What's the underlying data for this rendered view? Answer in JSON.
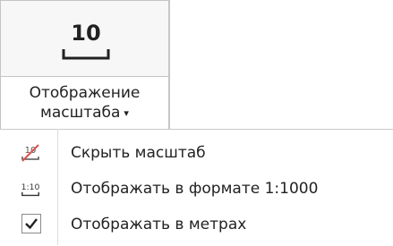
{
  "ribbon_button": {
    "icon_text": "10",
    "label_line1": "Отображение",
    "label_line2": "масштаба",
    "caret": "▾"
  },
  "menu": {
    "items": [
      {
        "label": "Скрыть масштаб",
        "icon": "hide-scale-icon"
      },
      {
        "label": "Отображать в формате 1:1000",
        "icon": "ratio-scale-icon"
      },
      {
        "label": "Отображать в метрах",
        "icon": "checked-checkbox-icon",
        "checked": true
      }
    ]
  },
  "icons": {
    "hide_text": "10",
    "ratio_text": "1:10"
  },
  "colors": {
    "strike": "#d9534f",
    "check": "#222222"
  }
}
